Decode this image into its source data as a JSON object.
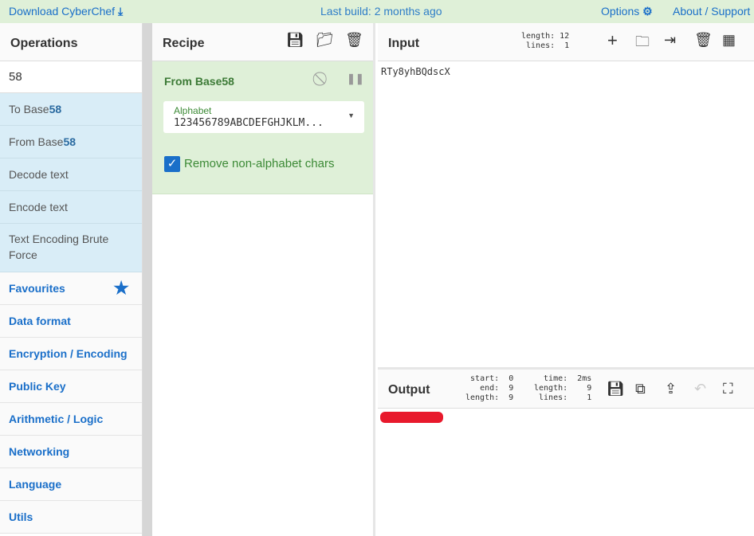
{
  "top": {
    "download": "Download CyberChef",
    "build": "Last build: 2 months ago",
    "options": "Options",
    "about": "About / Support"
  },
  "operations": {
    "title": "Operations",
    "search": "58",
    "results": [
      {
        "pre": "To Base",
        "hl": "58"
      },
      {
        "pre": "From Base",
        "hl": "58"
      },
      {
        "pre": "Decode text",
        "hl": ""
      },
      {
        "pre": "Encode text",
        "hl": ""
      },
      {
        "pre": "Text Encoding Brute Force",
        "hl": ""
      }
    ],
    "categories": [
      "Favourites",
      "Data format",
      "Encryption / Encoding",
      "Public Key",
      "Arithmetic / Logic",
      "Networking",
      "Language",
      "Utils"
    ]
  },
  "recipe": {
    "title": "Recipe",
    "operation": "From Base58",
    "alphabet_label": "Alphabet",
    "alphabet_value": "123456789ABCDEFGHJKLM...",
    "checkbox_label": "Remove non-alphabet chars",
    "checkbox_checked": true
  },
  "input": {
    "title": "Input",
    "stats": "length: 12\n lines:  1",
    "value": "RTy8yhBQdscX"
  },
  "output": {
    "title": "Output",
    "stats1": "start:  0\n  end:  9\nlength:  9",
    "stats2": "time:  2ms\nlength:    9\nlines:    1",
    "redacted": true
  },
  "colors": {
    "accent": "#1a6fc9",
    "recipe_bg": "#dff0d8",
    "ops_bg": "#d9edf7",
    "redaction": "#e8192c"
  }
}
